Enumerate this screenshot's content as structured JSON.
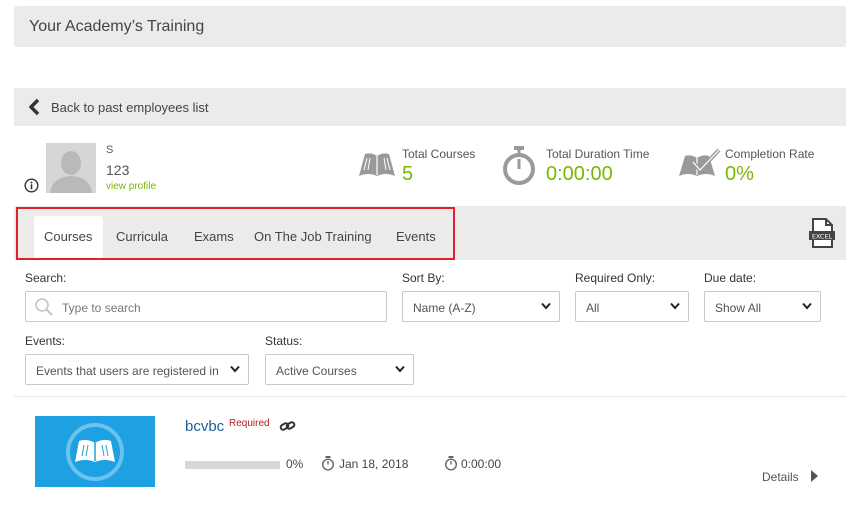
{
  "header": {
    "title": "Your Academy’s Training"
  },
  "back": {
    "label": "Back to past employees list"
  },
  "user": {
    "name": "S",
    "id": "123",
    "view_profile": "view profile"
  },
  "stats": [
    {
      "label": "Total Courses",
      "value": "5",
      "icon": "book-icon"
    },
    {
      "label": "Total Duration Time",
      "value": "0:00:00",
      "icon": "stopwatch-icon"
    },
    {
      "label": "Completion Rate",
      "value": "0%",
      "icon": "book-check-icon"
    }
  ],
  "tabs": [
    {
      "label": "Courses",
      "active": true
    },
    {
      "label": "Curricula",
      "active": false
    },
    {
      "label": "Exams",
      "active": false
    },
    {
      "label": "On The Job Training",
      "active": false
    },
    {
      "label": "Events",
      "active": false
    }
  ],
  "export": {
    "icon": "excel-export-icon",
    "text": "EXCEL"
  },
  "filters": {
    "search_label": "Search:",
    "search_placeholder": "Type to search",
    "sort_label": "Sort By:",
    "sort_value": "Name (A-Z)",
    "required_label": "Required Only:",
    "required_value": "All",
    "due_label": "Due date:",
    "due_value": "Show All",
    "events_label": "Events:",
    "events_value": "Events that users are registered in",
    "status_label": "Status:",
    "status_value": "Active Courses"
  },
  "courses": [
    {
      "name": "bcvbc",
      "required": "Required",
      "progress_percent": 0,
      "progress_label": "0%",
      "date": "Jan 18, 2018",
      "duration": "0:00:00",
      "details": "Details"
    }
  ],
  "colors": {
    "accent_green": "#7ab800",
    "link_blue": "#1b5e9a",
    "thumb_blue": "#1da1e2",
    "highlight_red": "#e0202a"
  }
}
